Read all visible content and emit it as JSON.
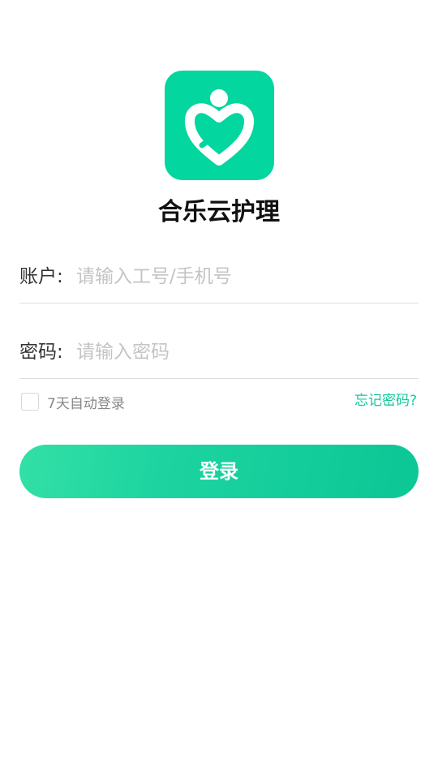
{
  "app": {
    "title": "合乐云护理",
    "brand_color": "#03d69e"
  },
  "logo": {
    "icon": "heart-person-icon"
  },
  "form": {
    "account": {
      "label": "账户:",
      "placeholder": "请输入工号/手机号",
      "value": ""
    },
    "password": {
      "label": "密码:",
      "placeholder": "请输入密码",
      "value": ""
    },
    "remember": {
      "label": "7天自动登录",
      "checked": false
    },
    "forgot_password": "忘记密码?",
    "login_button": "登录"
  }
}
